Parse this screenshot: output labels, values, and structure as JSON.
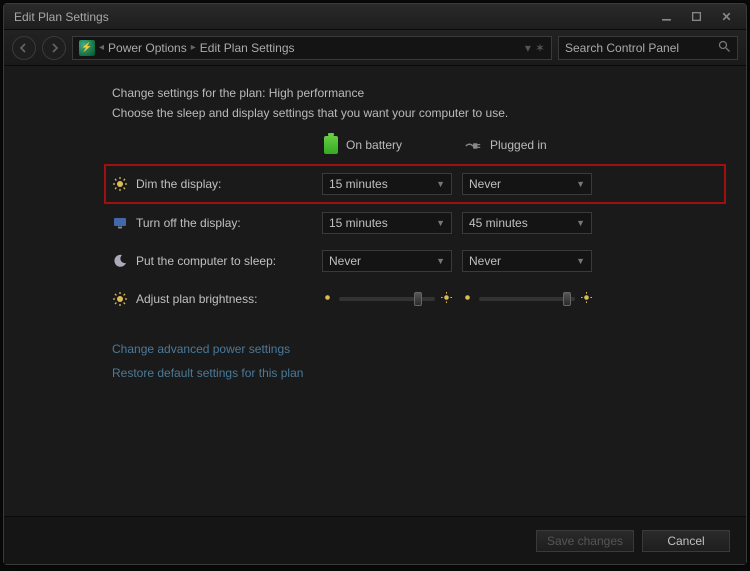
{
  "window": {
    "title": "Edit Plan Settings"
  },
  "breadcrumb": {
    "items": [
      "Power Options",
      "Edit Plan Settings"
    ]
  },
  "search": {
    "placeholder": "Search Control Panel"
  },
  "main": {
    "heading": "Change settings for the plan: High performance",
    "sub": "Choose the sleep and display settings that you want your computer to use.",
    "col_battery": "On battery",
    "col_plugged": "Plugged in"
  },
  "rows": {
    "dim": {
      "label": "Dim the display:",
      "battery": "15 minutes",
      "plugged": "Never"
    },
    "off": {
      "label": "Turn off the display:",
      "battery": "15 minutes",
      "plugged": "45 minutes"
    },
    "sleep": {
      "label": "Put the computer to sleep:",
      "battery": "Never",
      "plugged": "Never"
    },
    "bright": {
      "label": "Adjust plan brightness:"
    }
  },
  "links": {
    "advanced": "Change advanced power settings",
    "restore": "Restore default settings for this plan"
  },
  "footer": {
    "save": "Save changes",
    "cancel": "Cancel"
  }
}
